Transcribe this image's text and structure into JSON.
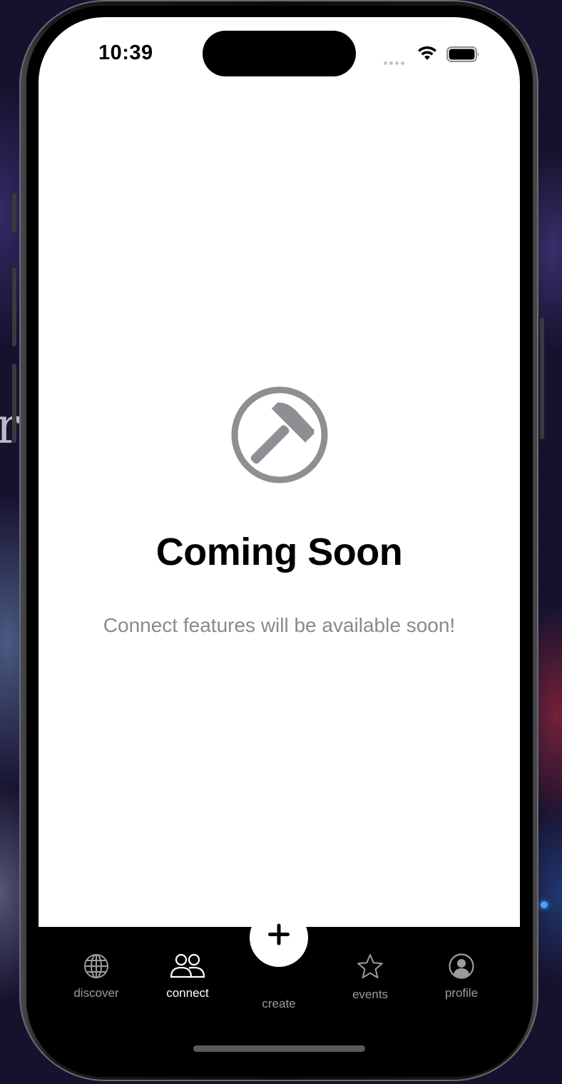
{
  "status_bar": {
    "time": "10:39"
  },
  "main": {
    "icon": "hammer-icon",
    "title": "Coming Soon",
    "subtitle": "Connect features will be available soon!"
  },
  "tab_bar": {
    "active_tab": "connect",
    "tabs": [
      {
        "label": "discover",
        "icon": "globe-icon"
      },
      {
        "label": "connect",
        "icon": "people-icon"
      },
      {
        "label": "create",
        "icon": "plus-icon"
      },
      {
        "label": "events",
        "icon": "star-icon"
      },
      {
        "label": "profile",
        "icon": "person-circle-icon"
      }
    ]
  },
  "colors": {
    "active_tab": "#ffffff",
    "inactive_tab": "#9c9ca0",
    "icon_gray": "#8e8e93",
    "subtitle": "#8a8a8e"
  }
}
